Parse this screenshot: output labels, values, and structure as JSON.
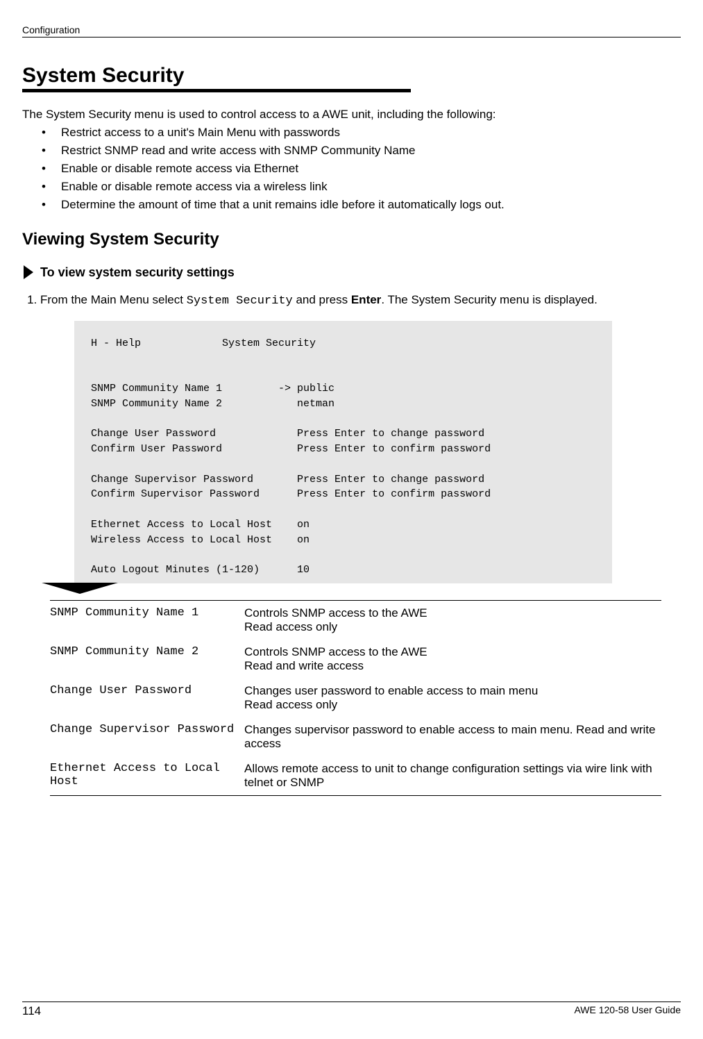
{
  "header": {
    "section": "Configuration"
  },
  "h1": "System Security",
  "intro": "The System Security menu is used to control access to a AWE unit, including the following:",
  "bullets": [
    "Restrict access to a unit's Main Menu with passwords",
    "Restrict SNMP read and write access with SNMP Community Name",
    "Enable or disable remote access via Ethernet",
    "Enable or disable remote access via a wireless link",
    "Determine the amount of time that a unit remains idle before it automatically logs out."
  ],
  "h2": "Viewing System Security",
  "procedure_title": "To view system security settings",
  "step": {
    "prefix": "From the Main Menu select ",
    "mono": "System Security",
    "mid": " and press ",
    "bold": "Enter",
    "suffix": ". The System Security menu is displayed."
  },
  "terminal": "H - Help             System Security\n\n\nSNMP Community Name 1         -> public\nSNMP Community Name 2            netman\n\nChange User Password             Press Enter to change password\nConfirm User Password            Press Enter to confirm password\n\nChange Supervisor Password       Press Enter to change password\nConfirm Supervisor Password      Press Enter to confirm password\n\nEthernet Access to Local Host    on\nWireless Access to Local Host    on\n\nAuto Logout Minutes (1-120)      10",
  "defs": [
    {
      "term": "SNMP Community Name 1",
      "desc_l1": "Controls SNMP access to the AWE",
      "desc_l2": "Read access only"
    },
    {
      "term": "SNMP Community Name 2",
      "desc_l1": "Controls SNMP access to the AWE",
      "desc_l2": "Read and write access"
    },
    {
      "term": "Change User Password",
      "desc_l1": "Changes user password to enable access to main menu",
      "desc_l2": "Read access only"
    },
    {
      "term": "Change Supervisor Password",
      "desc_l1": "Changes supervisor password to enable access to main menu. Read and write access",
      "desc_l2": ""
    },
    {
      "term": "Ethernet Access to Local Host",
      "desc_l1": "Allows remote access to unit to change configuration settings via wire link with telnet or SNMP",
      "desc_l2": ""
    }
  ],
  "footer": {
    "page": "114",
    "guide": "AWE 120-58 User Guide"
  }
}
